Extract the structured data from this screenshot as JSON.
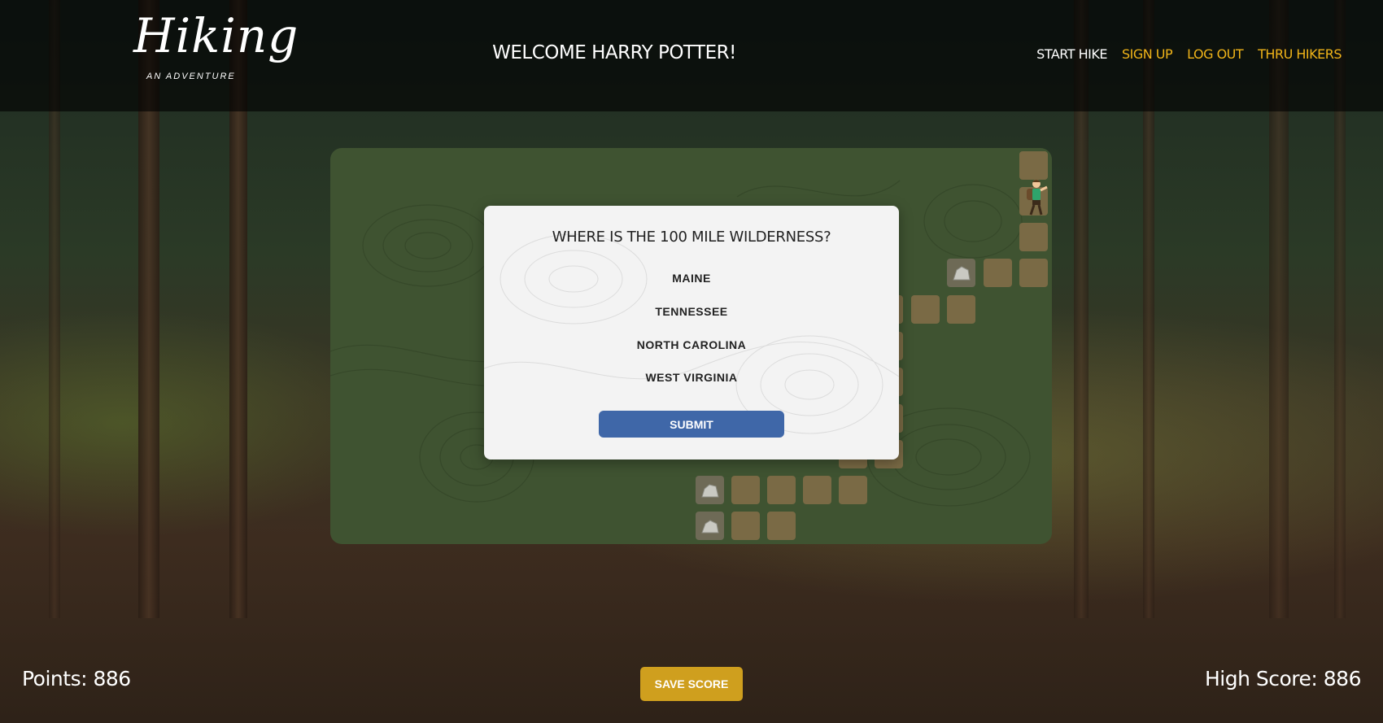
{
  "header": {
    "logo_title": "Hiking",
    "logo_tagline": "AN ADVENTURE",
    "welcome": "WELCOME HARRY POTTER!",
    "nav": [
      {
        "label": "START HIKE",
        "color": "#ffffff"
      },
      {
        "label": "SIGN UP",
        "color": "#f0b419"
      },
      {
        "label": "LOG OUT",
        "color": "#f0b419"
      },
      {
        "label": "THRU HIKERS",
        "color": "#f0b419"
      }
    ]
  },
  "modal": {
    "question": "WHERE IS THE 100 MILE WILDERNESS?",
    "options": [
      "MAINE",
      "TENNESSEE",
      "NORTH CAROLINA",
      "WEST VIRGINIA"
    ],
    "submit_label": "SUBMIT"
  },
  "footer": {
    "points": "Points: 886",
    "save_label": "SAVE SCORE",
    "high_score": "High Score: 886"
  },
  "colors": {
    "board": "#3f5331",
    "tile": "#7a6a45",
    "accent_gold": "#cf9f1e",
    "submit_blue": "#3f67a8"
  }
}
